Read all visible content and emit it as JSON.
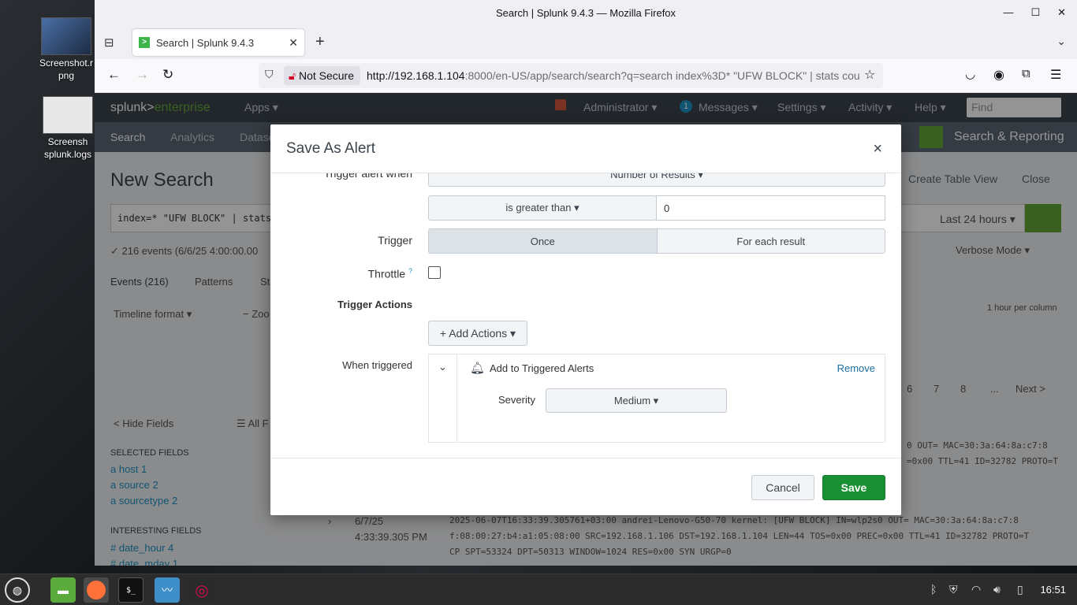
{
  "desktop": {
    "icons": [
      {
        "label": "Screenshot.png",
        "display": "Screenshot.r\npng"
      },
      {
        "label": "Screenshot splunk.logs",
        "display": "Screensh\nsplunk.logs"
      }
    ]
  },
  "browser": {
    "window_title": "Search | Splunk 9.4.3 — Mozilla Firefox",
    "tab_title": "Search | Splunk 9.4.3",
    "not_secure": "Not Secure",
    "url_host": "http://192.168.1.104",
    "url_rest": ":8000/en-US/app/search/search?q=search index%3D* \"UFW BLOCK\" | stats cou"
  },
  "splunk": {
    "logo_a": "splunk>",
    "logo_b": "enterprise",
    "menu": {
      "apps": "Apps ▾",
      "admin": "Administrator ▾",
      "messages_count": "1",
      "messages": "Messages ▾",
      "settings": "Settings ▾",
      "activity": "Activity ▾",
      "help": "Help ▾",
      "find": "Find"
    },
    "app_bar": {
      "search": "Search",
      "analytics": "Analytics",
      "datasets": "Datase",
      "app_name": "Search & Reporting"
    },
    "page_title": "New Search",
    "create_table": "Create Table View",
    "close": "Close",
    "query": "index=* \"UFW BLOCK\" | stats",
    "time_range": "Last 24 hours ▾",
    "events_summary": "✓ 216 events (6/6/25 4:00:00.00",
    "verbose": "Verbose Mode ▾",
    "tabs": {
      "events": "Events (216)",
      "patterns": "Patterns",
      "stats": "St"
    },
    "timeline": "Timeline format ▾",
    "zoom": "− Zoo",
    "per_column": "1 hour per column",
    "pagination": [
      "6",
      "7",
      "8",
      "...",
      "Next >"
    ],
    "hide_fields": "< Hide Fields",
    "all_fields": "☰ All F",
    "selected_fields_title": "SELECTED FIELDS",
    "selected_fields": [
      "a host 1",
      "a source 2",
      "a sourcetype 2"
    ],
    "interesting_fields_title": "INTERESTING FIELDS",
    "interesting_fields": [
      "# date_hour 4",
      "# date_mday 1"
    ],
    "event_row_1a": "0 OUT= MAC=30:3a:64:8a:c7:8",
    "event_row_1b": "=0x00 TTL=41 ID=32782 PROTO=T",
    "event_date": "6/7/25",
    "event_time": "4:33:39.305 PM",
    "event_line1": "2025-06-07T16:33:39.305761+03:00 andrei-Lenovo-G50-70 kernel: [UFW BLOCK] IN=wlp2s0 OUT= MAC=30:3a:64:8a:c7:8",
    "event_line2": "f:08:00:27:b4:a1:05:08:00 SRC=192.168.1.106 DST=192.168.1.104 LEN=44 TOS=0x00 PREC=0x00 TTL=41 ID=32782 PROTO=T",
    "event_line3": "CP SPT=53324 DPT=50313 WINDOW=1024 RES=0x00 SYN URGP=0"
  },
  "modal": {
    "title": "Save As Alert",
    "close": "×",
    "trigger_when_label": "Trigger alert when",
    "trigger_when_value": "Number of Results ▾",
    "condition": "is greater than ▾",
    "condition_value": "0",
    "trigger_label": "Trigger",
    "trigger_once": "Once",
    "trigger_each": "For each result",
    "throttle_label": "Throttle",
    "throttle_help": "?",
    "trigger_actions_label": "Trigger Actions",
    "add_actions": "+ Add Actions ▾",
    "when_triggered_label": "When triggered",
    "action_name": "Add to Triggered Alerts",
    "remove": "Remove",
    "severity_label": "Severity",
    "severity_value": "Medium ▾",
    "cancel": "Cancel",
    "save": "Save"
  },
  "taskbar": {
    "clock": "16:51"
  }
}
